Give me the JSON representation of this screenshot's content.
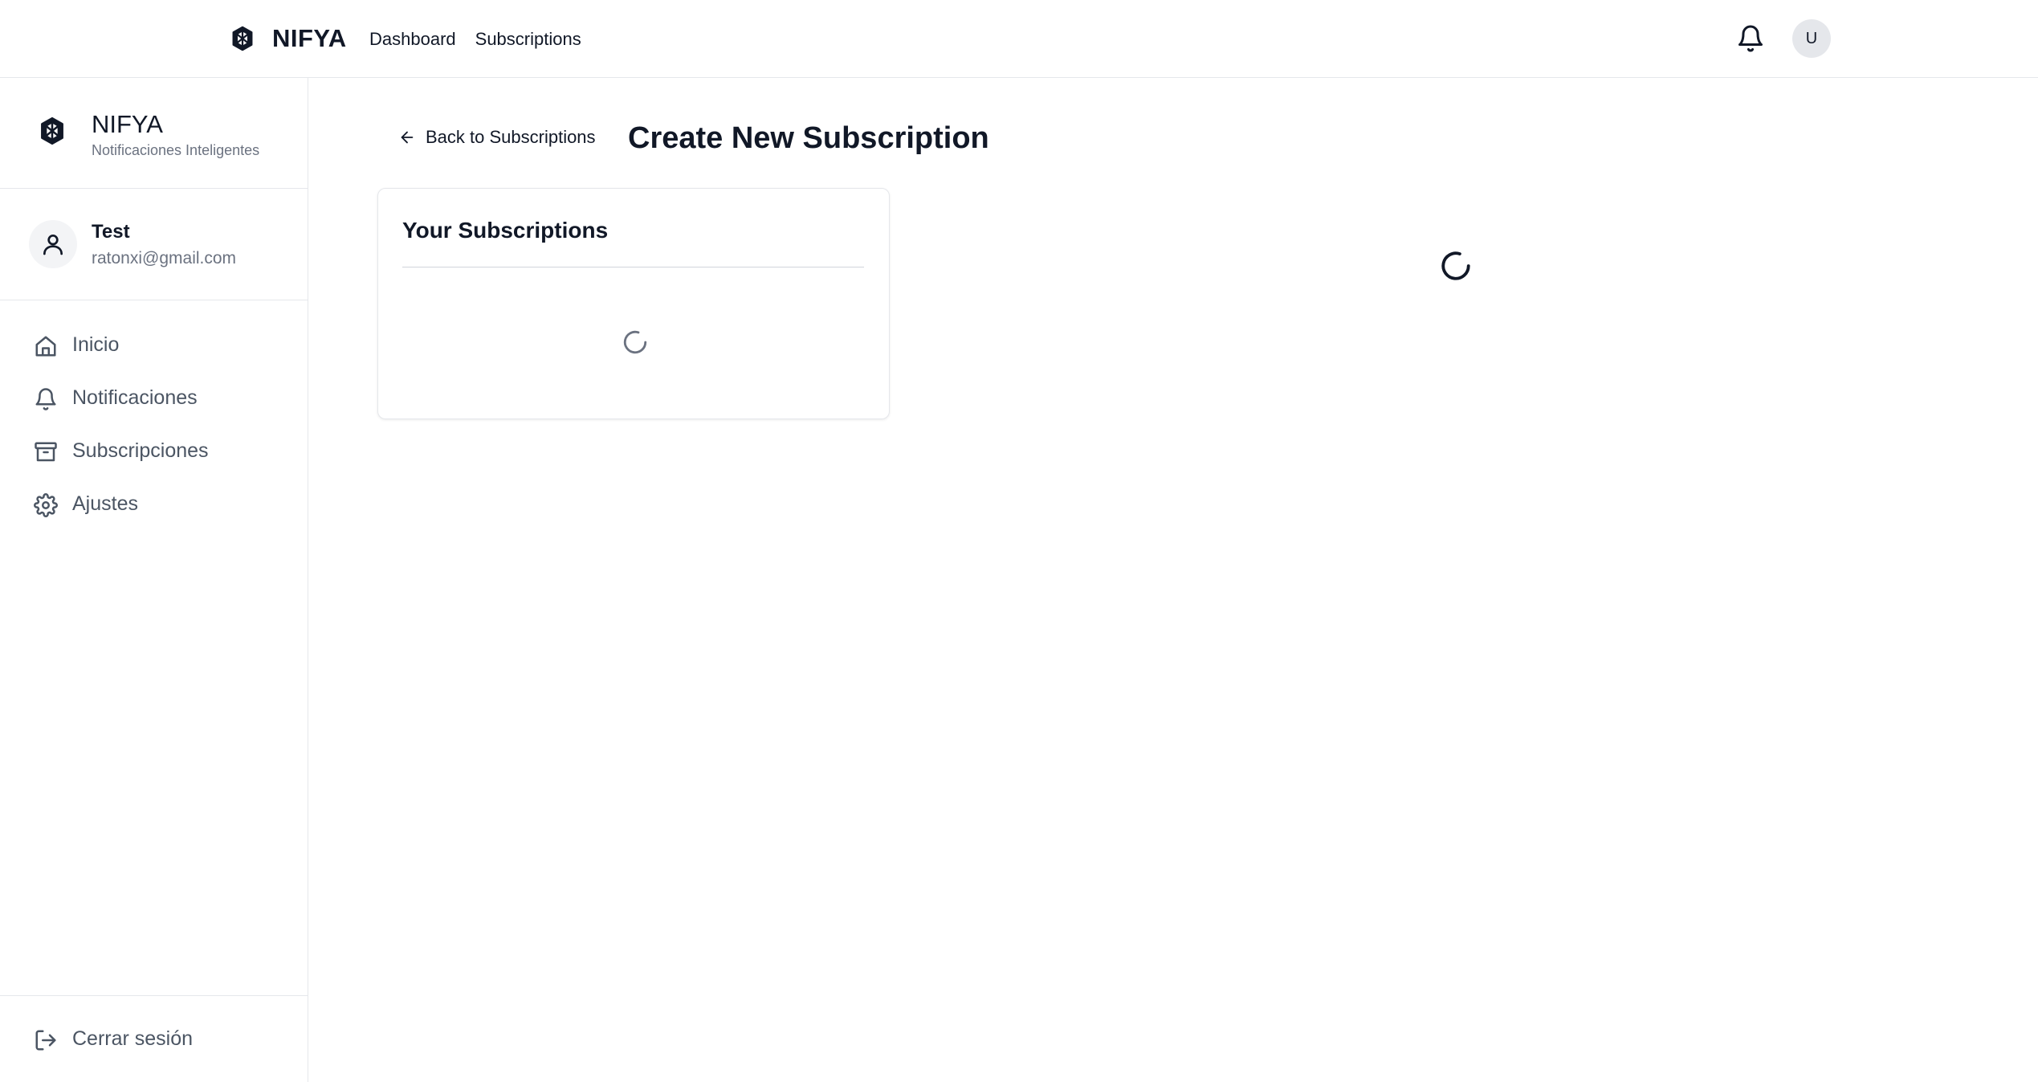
{
  "topbar": {
    "brand": "NIFYA",
    "nav": [
      {
        "label": "Dashboard"
      },
      {
        "label": "Subscriptions"
      }
    ],
    "avatar_initial": "U"
  },
  "sidebar": {
    "brand_title": "NIFYA",
    "brand_subtitle": "Notificaciones Inteligentes",
    "user": {
      "name": "Test",
      "email": "ratonxi@gmail.com"
    },
    "items": [
      {
        "label": "Inicio",
        "icon": "home-icon"
      },
      {
        "label": "Notificaciones",
        "icon": "bell-icon"
      },
      {
        "label": "Subscripciones",
        "icon": "archive-icon"
      },
      {
        "label": "Ajustes",
        "icon": "gear-icon"
      }
    ],
    "logout_label": "Cerrar sesión"
  },
  "main": {
    "back_label": "Back to Subscriptions",
    "title": "Create New Subscription",
    "card": {
      "title": "Your Subscriptions"
    }
  },
  "colors": {
    "text": "#111827",
    "muted": "#6b7280",
    "border": "#e5e7eb"
  }
}
